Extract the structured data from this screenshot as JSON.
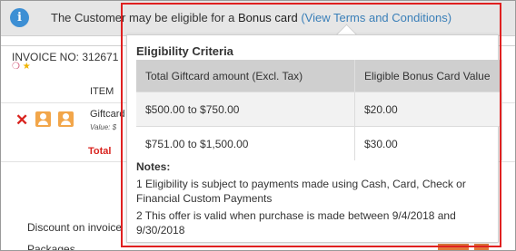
{
  "info_bar": {
    "text_prefix": "The Customer may be eligible for a",
    "brand": "Bonus card",
    "link_text": "(View Terms and Conditions)",
    "icon": "info-icon"
  },
  "background": {
    "invoice_label": "INVOICE NO: 312671",
    "mini_icons": [
      "tag-icon",
      "star-icon"
    ],
    "item_header": "ITEM",
    "giftcard_label": "Giftcard",
    "value_line": "Value: $",
    "total_label": "Total",
    "discount_label": "Discount on invoice",
    "packages_label": "Packages",
    "icons": [
      "remove-icon",
      "person-icon",
      "person-icon"
    ]
  },
  "popover": {
    "title": "Eligibility Criteria",
    "columns": [
      "Total Giftcard amount (Excl. Tax)",
      "Eligible Bonus Card Value"
    ],
    "rows": [
      [
        "$500.00 to $750.00",
        "$20.00"
      ],
      [
        "$751.00 to $1,500.00",
        "$30.00"
      ]
    ],
    "notes_heading": "Notes:",
    "notes": [
      "1 Eligibility is subject to payments made using Cash, Card, Check or Financial Custom Payments",
      "2 This offer is valid when purchase is made between 9/4/2018 and 9/30/2018"
    ]
  },
  "colors": {
    "highlight": "#e02020",
    "link": "#3a7fb8",
    "info_icon": "#3d8fd4",
    "accent_orange": "#f2a64a",
    "danger": "#d9241f"
  }
}
